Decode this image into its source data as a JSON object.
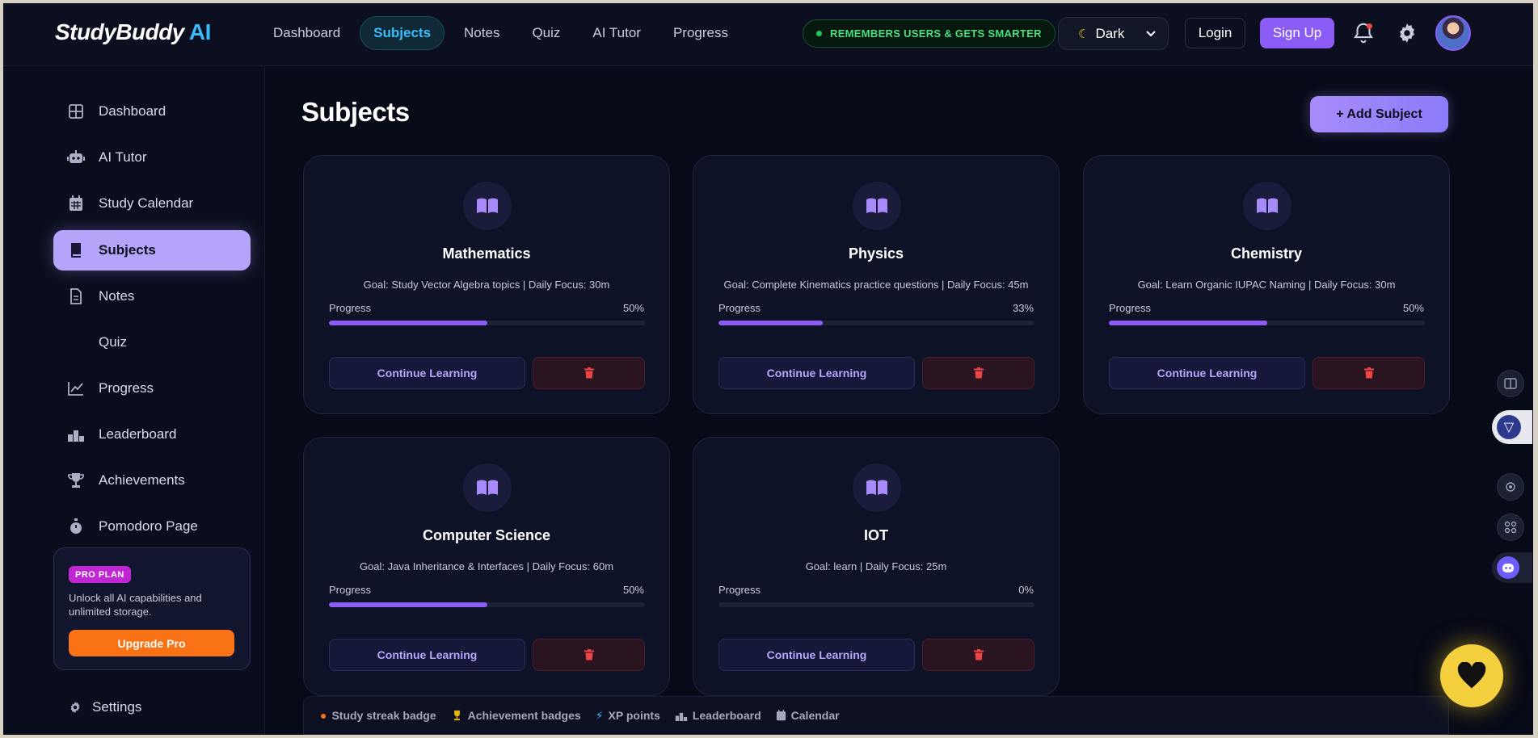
{
  "brand": {
    "name": "StudyBuddy",
    "suffix": "AI"
  },
  "nav": {
    "links": [
      "Dashboard",
      "Subjects",
      "Notes",
      "Quiz",
      "AI Tutor",
      "Progress"
    ],
    "active": "Subjects",
    "memory_pill": "REMEMBERS USERS & GETS SMARTER",
    "theme": {
      "icon": "moon-icon",
      "label": "Dark"
    },
    "login": "Login",
    "signup": "Sign Up"
  },
  "sidebar": {
    "items": [
      {
        "label": "Dashboard",
        "icon": "grid-icon"
      },
      {
        "label": "AI Tutor",
        "icon": "robot-icon"
      },
      {
        "label": "Study Calendar",
        "icon": "calendar-icon"
      },
      {
        "label": "Subjects",
        "icon": "book-icon",
        "active": true
      },
      {
        "label": "Notes",
        "icon": "file-icon"
      },
      {
        "label": "Quiz",
        "icon": ""
      },
      {
        "label": "Progress",
        "icon": "chart-line-icon"
      },
      {
        "label": "Leaderboard",
        "icon": "podium-icon"
      },
      {
        "label": "Achievements",
        "icon": "trophy-icon"
      },
      {
        "label": "Pomodoro Page",
        "icon": "stopwatch-icon"
      }
    ],
    "pro": {
      "badge": "PRO PLAN",
      "text": "Unlock all AI capabilities and unlimited storage.",
      "button": "Upgrade Pro"
    },
    "settings": "Settings"
  },
  "main": {
    "title": "Subjects",
    "add_button": "+ Add Subject",
    "progress_label": "Progress",
    "continue_label": "Continue Learning",
    "subjects": [
      {
        "name": "Mathematics",
        "goal": "Goal: Study Vector Algebra topics | Daily Focus: 30m",
        "progress": 50,
        "progress_text": "50%"
      },
      {
        "name": "Physics",
        "goal": "Goal: Complete Kinematics practice questions | Daily Focus: 45m",
        "progress": 33,
        "progress_text": "33%"
      },
      {
        "name": "Chemistry",
        "goal": "Goal: Learn Organic IUPAC Naming | Daily Focus: 30m",
        "progress": 50,
        "progress_text": "50%"
      },
      {
        "name": "Computer Science",
        "goal": "Goal: Java Inheritance & Interfaces | Daily Focus: 60m",
        "progress": 50,
        "progress_text": "50%"
      },
      {
        "name": "IOT",
        "goal": "Goal: learn | Daily Focus: 25m",
        "progress": 0,
        "progress_text": "0%"
      }
    ]
  },
  "footer": {
    "items": [
      {
        "label": "Study streak badge",
        "icon": "flame-icon",
        "color": "#f97316"
      },
      {
        "label": "Achievement badges",
        "icon": "trophy-icon",
        "color": "#eab308"
      },
      {
        "label": "XP points",
        "icon": "bolt-icon",
        "color": "#38bdf8"
      },
      {
        "label": "Leaderboard",
        "icon": "podium-icon",
        "color": "#a4a9c0"
      },
      {
        "label": "Calendar",
        "icon": "calendar-icon",
        "color": "#a4a9c0"
      }
    ]
  },
  "colors": {
    "accent": "#8b5cf6",
    "brand_ai": "#38bdf8",
    "danger": "#ef4444",
    "upgrade": "#f97316",
    "fab": "#f4d03f"
  }
}
